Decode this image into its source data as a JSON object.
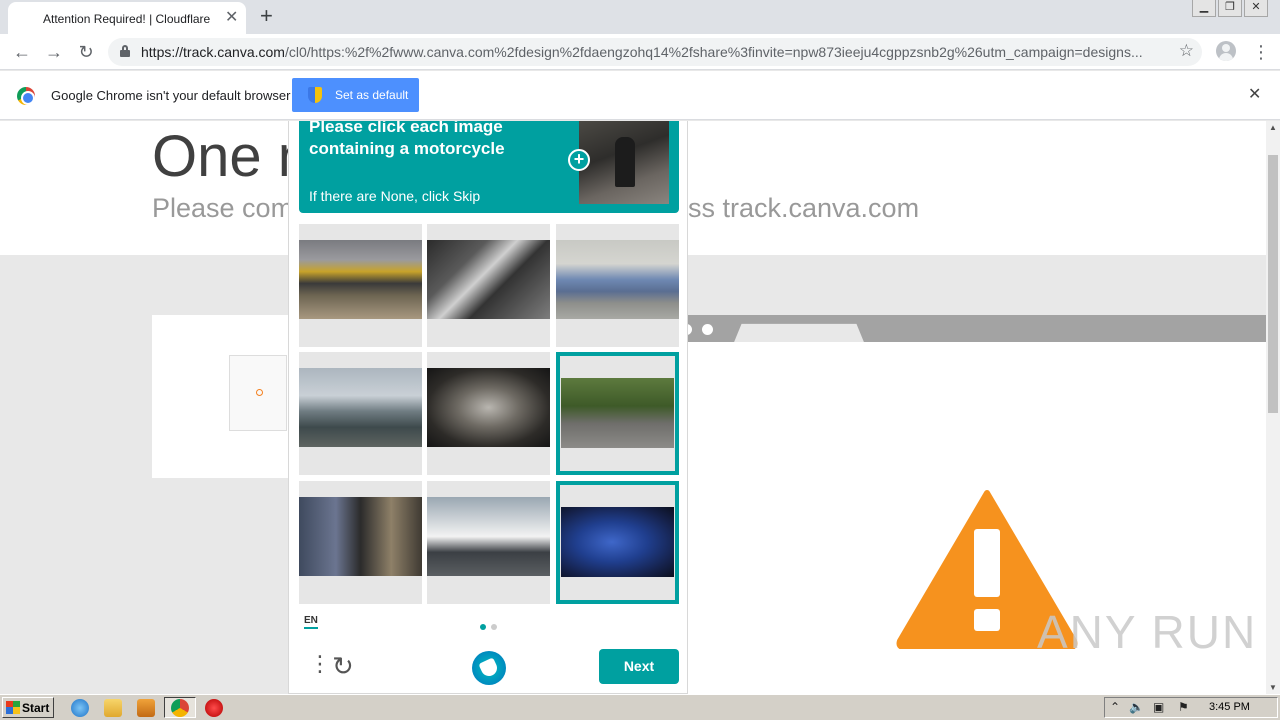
{
  "browser": {
    "tab_title": "Attention Required! | Cloudflare",
    "url_host": "https://track.canva.com",
    "url_path": "/cl0/https:%2f%2fwww.canva.com%2fdesign%2fdaengzohq14%2fshare%3finvite=npw873ieeju4cgppzsnb2g%26utm_campaign=designs...",
    "window_controls": [
      "minimize",
      "restore",
      "close"
    ]
  },
  "infobar": {
    "message": "Google Chrome isn't your default browser",
    "button_label": "Set as default"
  },
  "page": {
    "heading_partial": "One m",
    "subheading_left": "Please com",
    "subheading_right": "ss track.canva.com"
  },
  "captcha": {
    "prompt": "Please click each image containing a motorcycle",
    "prompt_hint": "If there are None, click Skip",
    "images": [
      {
        "subject": "train",
        "selected": false
      },
      {
        "subject": "cyclists",
        "selected": false
      },
      {
        "subject": "car",
        "selected": false
      },
      {
        "subject": "airplane",
        "selected": false
      },
      {
        "subject": "star emblem",
        "selected": false
      },
      {
        "subject": "motorcycle on road",
        "selected": true
      },
      {
        "subject": "people",
        "selected": false
      },
      {
        "subject": "bus",
        "selected": false
      },
      {
        "subject": "motorcycle",
        "selected": true
      }
    ],
    "language": "EN",
    "page_indicator": {
      "current": 1,
      "total": 2
    },
    "next_label": "Next",
    "accent_color": "#00a0a0"
  },
  "watermark": "ANY RUN",
  "taskbar": {
    "start_label": "Start",
    "clock": "3:45 PM"
  }
}
